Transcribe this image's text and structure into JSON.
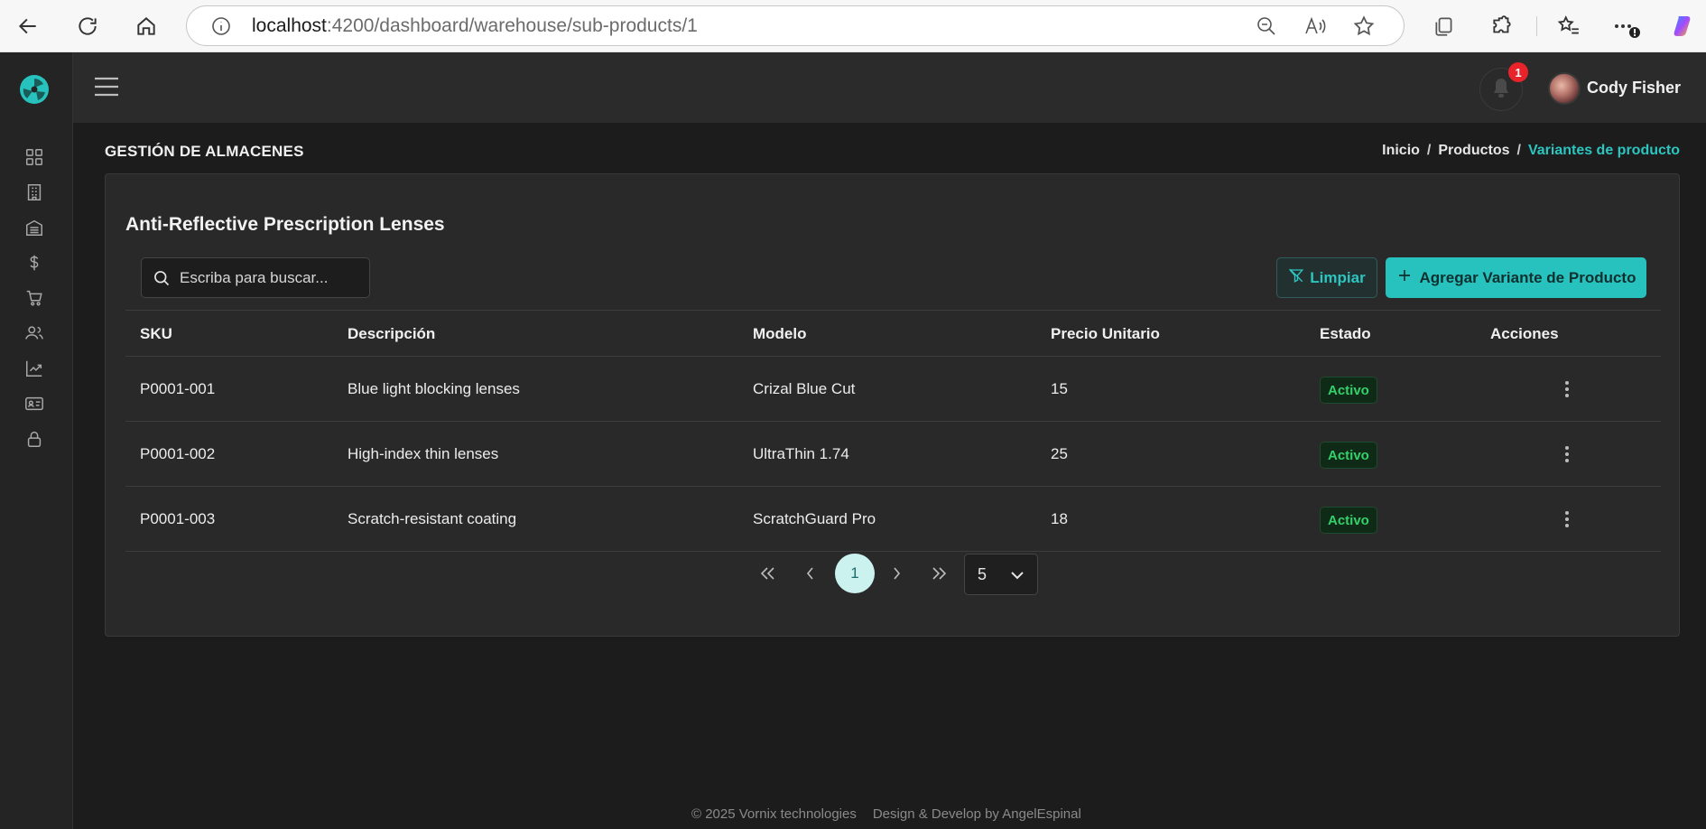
{
  "browser": {
    "url_host": "localhost",
    "url_rest": ":4200/dashboard/warehouse/sub-products/1"
  },
  "topbar": {
    "notifications_count": "1",
    "user_name": "Cody Fisher"
  },
  "header": {
    "title": "GESTIÓN DE ALMACENES",
    "breadcrumb": [
      "Inicio",
      "Productos",
      "Variantes de producto"
    ],
    "breadcrumb_sep": "/"
  },
  "card": {
    "title": "Anti-Reflective Prescription Lenses",
    "search_placeholder": "Escriba para buscar...",
    "clear_label": "Limpiar",
    "add_label": "Agregar Variante de Producto"
  },
  "table": {
    "columns": [
      "SKU",
      "Descripción",
      "Modelo",
      "Precio Unitario",
      "Estado",
      "Acciones"
    ],
    "rows": [
      {
        "sku": "P0001-001",
        "description": "Blue light blocking lenses",
        "model": "Crizal Blue Cut",
        "price": "15",
        "status": "Activo"
      },
      {
        "sku": "P0001-002",
        "description": "High-index thin lenses",
        "model": "UltraThin 1.74",
        "price": "25",
        "status": "Activo"
      },
      {
        "sku": "P0001-003",
        "description": "Scratch-resistant coating",
        "model": "ScratchGuard Pro",
        "price": "18",
        "status": "Activo"
      }
    ]
  },
  "pagination": {
    "current_page": "1",
    "page_size": "5"
  },
  "footer": {
    "copyright": "© 2025 Vornix technologies",
    "credit": "Design & Develop by AngelEspinal"
  },
  "colors": {
    "accent": "#27c2bd",
    "active_status": "#35d06a",
    "badge": "#e8232a"
  }
}
